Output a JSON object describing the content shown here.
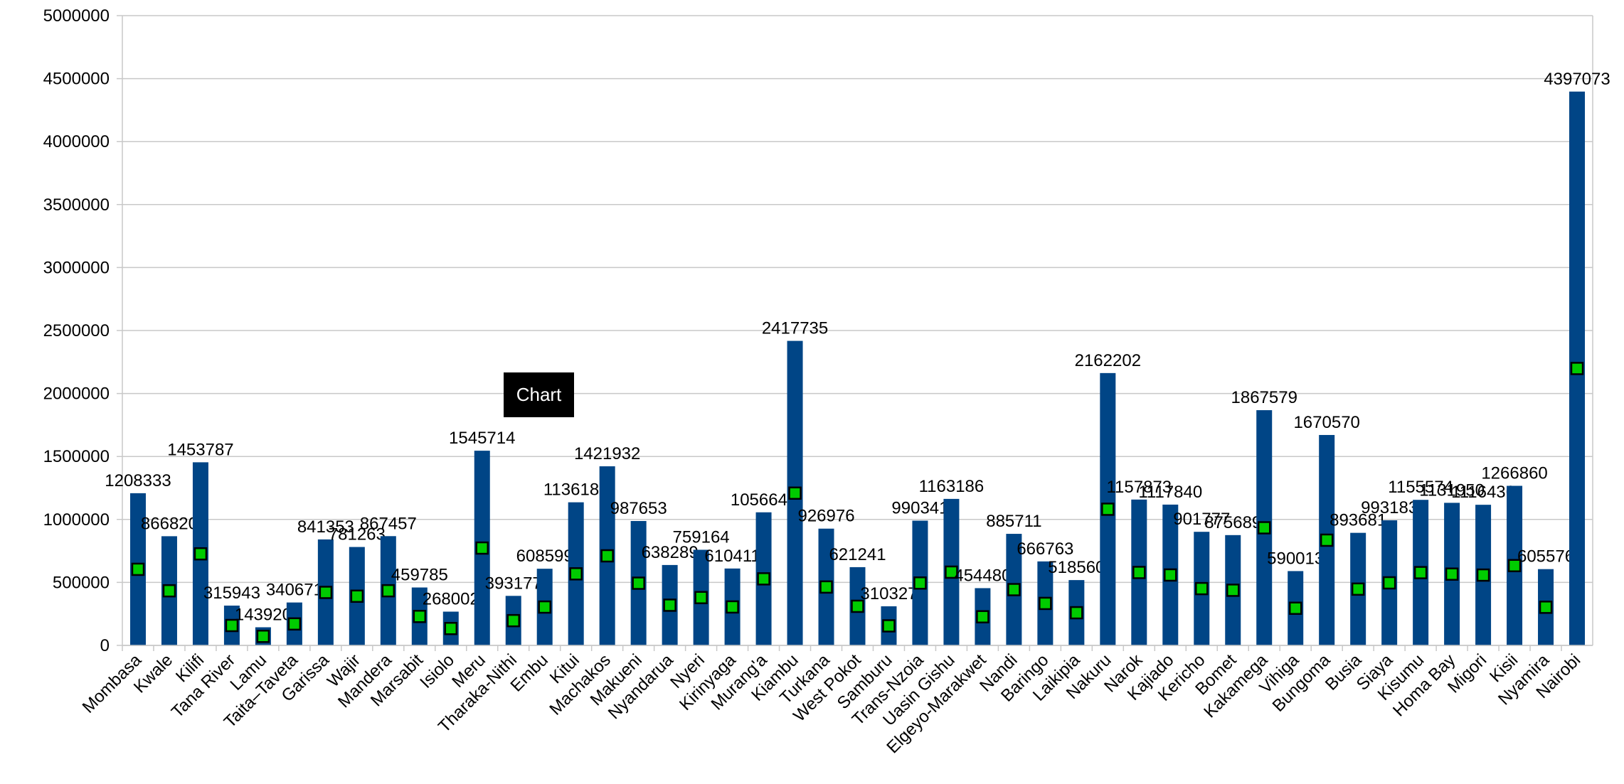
{
  "title": "Chart",
  "colors": {
    "bar": "#004586",
    "marker": "#00cc00",
    "marker_border": "#000000",
    "grid": "#c8c8c8"
  },
  "chart_data": {
    "type": "bar",
    "ylim": [
      0,
      5000000
    ],
    "yticks": [
      0,
      500000,
      1000000,
      1500000,
      2000000,
      2500000,
      3000000,
      3500000,
      4000000,
      4500000,
      5000000
    ],
    "grid": true,
    "legend": "none",
    "categories": [
      "Mombasa",
      "Kwale",
      "Kilifi",
      "Tana River",
      "Lamu",
      "Taita–Taveta",
      "Garissa",
      "Wajir",
      "Mandera",
      "Marsabit",
      "Isiolo",
      "Meru",
      "Tharaka-Nithi",
      "Embu",
      "Kitui",
      "Machakos",
      "Makueni",
      "Nyandarua",
      "Nyeri",
      "Kirinyaga",
      "Murang'a",
      "Kiambu",
      "Turkana",
      "West Pokot",
      "Samburu",
      "Trans-Nzoia",
      "Uasin Gishu",
      "Elgeyo-Marakwet",
      "Nandi",
      "Baringo",
      "Laikipia",
      "Nakuru",
      "Narok",
      "Kajiado",
      "Kericho",
      "Bomet",
      "Kakamega",
      "Vihiga",
      "Bungoma",
      "Busia",
      "Siaya",
      "Kisumu",
      "Homa Bay",
      "Migori",
      "Kisii",
      "Nyamira",
      "Nairobi"
    ],
    "series": [
      {
        "type": "bar",
        "values": [
          1208333,
          866820,
          1453787,
          315943,
          143920,
          340671,
          841353,
          781263,
          867457,
          459785,
          268002,
          1545714,
          393177,
          608599,
          1136187,
          1421932,
          987653,
          638289,
          759164,
          610411,
          1056640,
          2417735,
          926976,
          621241,
          310327,
          990341,
          1163186,
          454480,
          885711,
          666763,
          518560,
          2162202,
          1157873,
          1117840,
          901777,
          875689,
          1867579,
          590013,
          1670570,
          893681,
          993183,
          1155574,
          1131950,
          1116436,
          1266860,
          605576,
          4397073
        ]
      },
      {
        "type": "markers",
        "values": [
          604167,
          433410,
          726894,
          157972,
          71960,
          170336,
          420677,
          390632,
          433729,
          229893,
          134001,
          772857,
          196589,
          304300,
          568094,
          710966,
          493827,
          319145,
          379582,
          305206,
          528320,
          1208868,
          463488,
          310621,
          155164,
          495171,
          581593,
          227240,
          442856,
          333382,
          259280,
          1081101,
          578937,
          558920,
          450889,
          437845,
          933790,
          295007,
          835285,
          446841,
          496592,
          577787,
          565975,
          558218,
          633430,
          302788,
          2198537
        ]
      }
    ]
  }
}
